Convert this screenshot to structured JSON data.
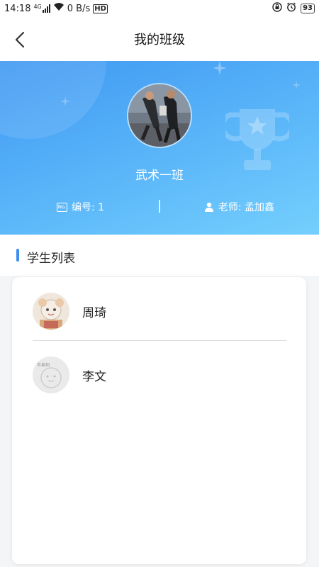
{
  "status_bar": {
    "time": "14:18",
    "network_type": "4G",
    "data_speed": "0 B/s",
    "hd_label": "HD",
    "battery": "93"
  },
  "nav": {
    "title": "我的班级",
    "back_icon": "chevron-left-icon"
  },
  "class_info": {
    "name": "武术一班",
    "number_label": "编号: 1",
    "teacher_label": "老师: 孟加鑫",
    "number_icon": "no-icon",
    "teacher_icon": "person-icon",
    "gradient_start": "#3f98f2",
    "gradient_end": "#74cffd"
  },
  "students_section": {
    "title": "学生列表",
    "accent": "#3f8ef0",
    "items": [
      {
        "name": "周琦",
        "avatar": "cartoon-child-avatar"
      },
      {
        "name": "李文",
        "avatar": "default-placeholder-avatar",
        "avatar_text": "苹果相"
      }
    ]
  }
}
